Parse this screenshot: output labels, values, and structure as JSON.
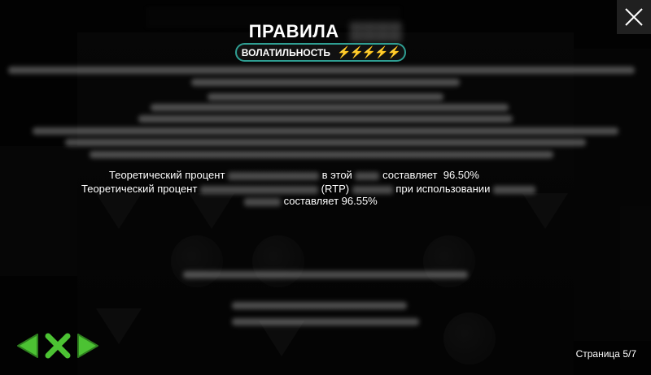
{
  "dialog": {
    "title": "ПРАВИЛА",
    "volatility_label": "ВОЛАТИЛЬНОСТЬ",
    "volatility_level": 5
  },
  "rtp": {
    "line1": {
      "prefix": "Теоретический процент",
      "mid": "в этой",
      "suffix": "составляет",
      "value": "96.50%"
    },
    "line2": {
      "prefix": "Теоретический процент",
      "mid": "(RTP)",
      "suffix": "при использовании"
    },
    "line3": {
      "suffix": "составляет 96.55%"
    }
  },
  "pager": {
    "label": "Страница 5/7"
  },
  "icons": {
    "close": "close-icon",
    "prev": "arrow-left-icon",
    "exit": "x-icon",
    "next": "arrow-right-icon",
    "volatility": "lightning-bolt-icon"
  },
  "colors": {
    "nav_green": "#4cc233",
    "vol_border": "#2f9e92",
    "bolt": "#ffd21a"
  }
}
